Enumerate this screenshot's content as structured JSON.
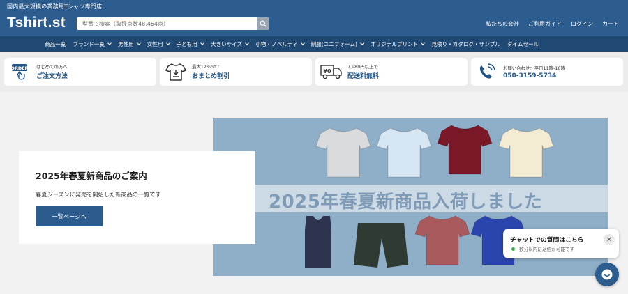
{
  "header": {
    "tagline": "国内最大規模の業務用Tシャツ専門店",
    "logo": "Tshirt.st",
    "search_placeholder": "型番で検索（取扱点数48,464点）",
    "links": [
      "私たちの会社",
      "ご利用ガイド",
      "ログイン",
      "カート"
    ]
  },
  "nav": {
    "items": [
      {
        "label": "商品一覧",
        "dropdown": false
      },
      {
        "label": "ブランド一覧",
        "dropdown": true
      },
      {
        "label": "男性用",
        "dropdown": true
      },
      {
        "label": "女性用",
        "dropdown": true
      },
      {
        "label": "子ども用",
        "dropdown": true
      },
      {
        "label": "大きいサイズ",
        "dropdown": true
      },
      {
        "label": "小物・ノベルティ",
        "dropdown": true
      },
      {
        "label": "制服(ユニフォーム)",
        "dropdown": true
      },
      {
        "label": "オリジナルプリント",
        "dropdown": true
      },
      {
        "label": "見積り・カタログ・サンプル",
        "dropdown": false
      },
      {
        "label": "タイムセール",
        "dropdown": false
      }
    ]
  },
  "features": [
    {
      "icon": "order-icon",
      "badge": "ORDER",
      "small": "はじめての方へ",
      "big": "ご注文方法"
    },
    {
      "icon": "tshirt-discount-icon",
      "small": "最大12%off♪",
      "big": "おまとめ割引"
    },
    {
      "icon": "delivery-truck-icon",
      "badge": "¥0",
      "small": "7,980円以上で",
      "big": "配送料無料"
    },
    {
      "icon": "phone-icon",
      "small": "お問い合わせ：平日11時-16時",
      "big": "050-3159-5734"
    }
  ],
  "hero": {
    "title": "2025年春夏新商品のご案内",
    "description": "春夏シーズンに発売を開始した新商品の一覧です",
    "button_label": "一覧ページへ",
    "banner_text": "2025年春夏新商品入荷しました",
    "banner_colors": [
      "#d9dbdd",
      "#d6e6f2",
      "#7a1828",
      "#f3ecd3",
      "#2e3350",
      "#2f3a33",
      "#a85a5c",
      "#2a45ad"
    ]
  },
  "chat": {
    "title": "チャットでの質問はこちら",
    "status": "数分以内に返信が可能です"
  },
  "colors": {
    "header_bg": "#2d5d8f",
    "nav_bg": "#1f4873",
    "accent": "#2b5c8d",
    "banner_bg": "#8faec8"
  }
}
